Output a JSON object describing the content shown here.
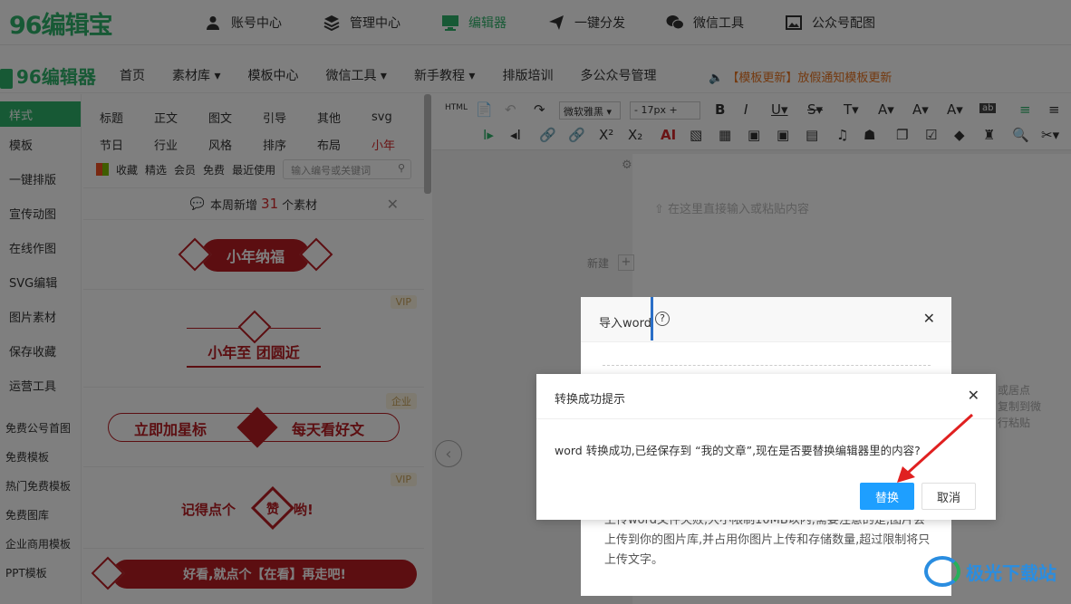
{
  "top": {
    "logo": "96编辑宝",
    "nav": [
      {
        "label": "账号中心",
        "icon": "user-icon"
      },
      {
        "label": "管理中心",
        "icon": "layers-icon"
      },
      {
        "label": "编辑器",
        "icon": "monitor-icon",
        "active": true
      },
      {
        "label": "一键分发",
        "icon": "paper-plane-icon"
      },
      {
        "label": "微信工具",
        "icon": "wechat-icon"
      },
      {
        "label": "公众号配图",
        "icon": "image-icon"
      }
    ]
  },
  "navbar": {
    "logo": "96编辑器",
    "links": [
      "首页",
      "素材库 ▾",
      "模板中心",
      "微信工具 ▾",
      "新手教程 ▾",
      "排版培训",
      "多公众号管理"
    ],
    "notice": "【模板更新】放假通知模板更新"
  },
  "left_menu": {
    "items": [
      "样式",
      "模板",
      "一键排版",
      "宣传动图",
      "在线作图",
      "SVG编辑",
      "图片素材",
      "保存收藏",
      "运营工具"
    ],
    "extras": [
      "免费公号首图",
      "免费模板",
      "热门免费模板",
      "免费图库",
      "企业商用模板",
      "PPT模板"
    ]
  },
  "materials": {
    "cat_row1": [
      "标题",
      "正文",
      "图文",
      "引导",
      "其他",
      "svg"
    ],
    "cat_row2": [
      "节日",
      "行业",
      "风格",
      "排序",
      "布局",
      "小年"
    ],
    "filters": [
      "收藏",
      "精选",
      "会员",
      "免费",
      "最近使用"
    ],
    "search_placeholder": "输入编号或关键词",
    "weekly_prefix": "本周新增",
    "weekly_count": "31",
    "weekly_suffix": "个素材",
    "cards": {
      "c1": "小年纳福",
      "c2_badge": "VIP",
      "c2": "小年至 团圆近",
      "c3_badge": "企业",
      "c3_left": "立即加星标",
      "c3_right": "每天看好文",
      "c4_badge": "VIP",
      "c4_left": "记得点个",
      "c4_mid": "赞",
      "c4_right": "哟!",
      "c5": "好看,就点个【在看】再走吧!"
    }
  },
  "toolbar": {
    "font": "微软雅黑",
    "size": "17px"
  },
  "editor": {
    "placeholder": "在这里直接输入或粘贴内容",
    "new_label": "新建",
    "side_text": [
      "或居点",
      "复制到微",
      "行粘贴"
    ]
  },
  "import_dialog": {
    "title": "导入word",
    "body": "上传word文件失败,大小限制10MB以内,需要注意的是,图片会上传到你的图片库,并占用你图片上传和存储数量,超过限制将只上传文字。"
  },
  "confirm_dialog": {
    "title": "转换成功提示",
    "message": "word 转换成功,已经保存到 “我的文章”,现在是否要替换编辑器里的内容?",
    "ok": "替换",
    "cancel": "取消"
  },
  "watermark": "极光下载站",
  "colors": {
    "brand": "#2fb36a",
    "primary_button": "#1e9fff",
    "accent_red": "#b81c22",
    "notice": "#e8731f"
  }
}
